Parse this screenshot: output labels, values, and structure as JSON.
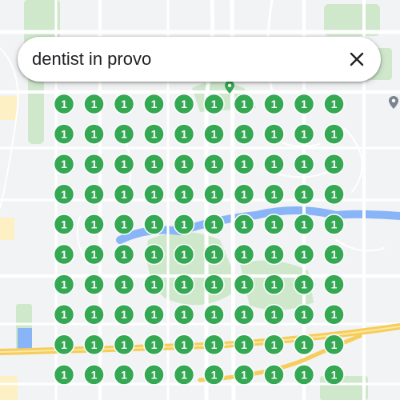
{
  "search": {
    "query": "dentist in provo",
    "clear_icon": "close-icon"
  },
  "colors": {
    "pin": "#34a853",
    "pin_border": "#ffffff",
    "pin_text": "#ffffff",
    "park": "#cfe8cc",
    "water": "#8ab4f8",
    "highway": "#f6cd5a",
    "road": "#ffffff",
    "land": "#f1f3f4"
  },
  "results": {
    "rows": 10,
    "cols": 10,
    "pin_label": "1",
    "pin_icon": "numbered-result-pin"
  },
  "poi_icons": [
    "park-marker-icon",
    "location-pin-icon"
  ]
}
